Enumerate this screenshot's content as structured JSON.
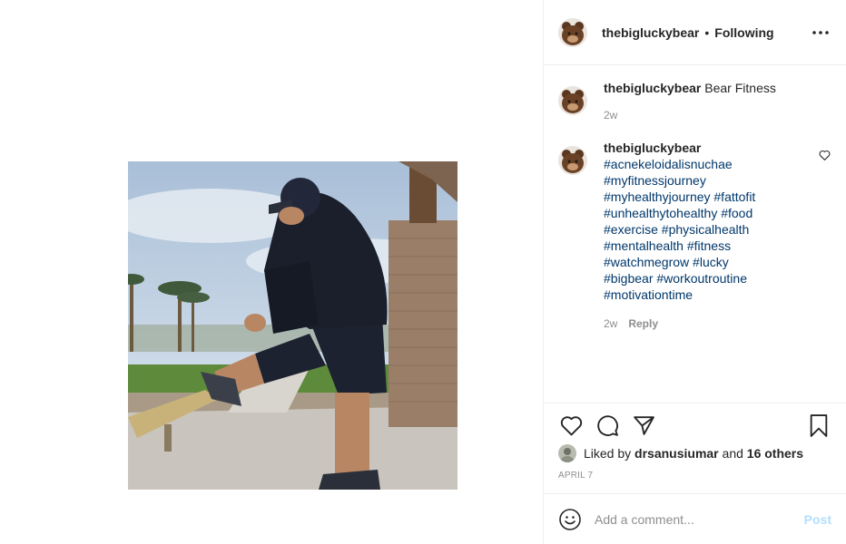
{
  "header": {
    "username": "thebigluckybear",
    "separator": "•",
    "follow_label": "Following",
    "more_icon": "more-options-icon"
  },
  "caption": {
    "username": "thebigluckybear",
    "text": "Bear Fitness",
    "time": "2w"
  },
  "comment": {
    "username": "thebigluckybear",
    "hashtags": [
      "#acnekeloidalisnuchae",
      "#myfitnessjourney",
      "#myhealthyjourney #fattofit",
      "#unhealthytohealthy #food",
      "#exercise #physicalhealth",
      "#mentalhealth #fitness",
      "#watchmegrow #lucky",
      "#bigbear #workoutroutine",
      "#motivationtime"
    ],
    "time": "2w",
    "reply_label": "Reply"
  },
  "actions": {
    "like_icon": "heart-icon",
    "comment_icon": "comment-icon",
    "share_icon": "share-icon",
    "save_icon": "bookmark-icon"
  },
  "likes": {
    "prefix": "Liked by",
    "user": "drsanusiumar",
    "and": "and",
    "others": "16 others"
  },
  "date": "APRIL 7",
  "add_comment": {
    "placeholder": "Add a comment...",
    "post_label": "Post"
  },
  "colors": {
    "link": "#00376b",
    "muted": "#8e8e8e",
    "post_disabled": "#b2dffc",
    "border": "#efefef"
  }
}
